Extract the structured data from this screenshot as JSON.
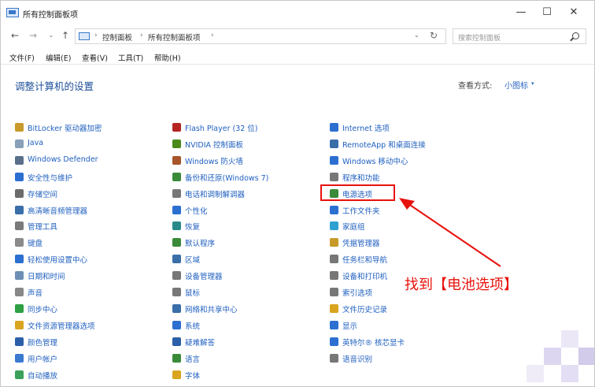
{
  "window": {
    "title": "所有控制面板项",
    "minimize": "—",
    "maximize": "☐",
    "close": "✕"
  },
  "nav": {
    "back": "←",
    "forward": "→",
    "recent": "⌄",
    "up": "↑",
    "refresh": "↻",
    "dropdown": "⌄"
  },
  "address": {
    "crumbs": [
      "控制面板",
      "所有控制面板项"
    ],
    "separator": "›"
  },
  "search": {
    "placeholder": "搜索控制面板"
  },
  "menu": [
    "文件(F)",
    "编辑(E)",
    "查看(V)",
    "工具(T)",
    "帮助(H)"
  ],
  "page": {
    "title": "调整计算机的设置",
    "view_label": "查看方式:",
    "view_value": "小图标",
    "view_arrow": "▾"
  },
  "columns": [
    [
      {
        "label": "BitLocker 驱动器加密",
        "icon": "bitlocker-icon",
        "color": "#c79a2a"
      },
      {
        "label": "Java",
        "icon": "java-icon",
        "color": "#8aa0b8"
      },
      {
        "label": "Windows Defender",
        "icon": "defender-icon",
        "color": "#5a6f8a"
      },
      {
        "label": "安全性与维护",
        "icon": "flag-icon",
        "color": "#2c6fd1"
      },
      {
        "label": "存储空间",
        "icon": "storage-icon",
        "color": "#6b6b6b"
      },
      {
        "label": "高清晰音频管理器",
        "icon": "audio-manager-icon",
        "color": "#3a6ea8"
      },
      {
        "label": "管理工具",
        "icon": "admin-tools-icon",
        "color": "#7a7a7a"
      },
      {
        "label": "键盘",
        "icon": "keyboard-icon",
        "color": "#8a8a8a"
      },
      {
        "label": "轻松使用设置中心",
        "icon": "ease-of-access-icon",
        "color": "#2c6fd1"
      },
      {
        "label": "日期和时间",
        "icon": "clock-icon",
        "color": "#6d8fb5"
      },
      {
        "label": "声音",
        "icon": "speaker-icon",
        "color": "#888"
      },
      {
        "label": "同步中心",
        "icon": "sync-icon",
        "color": "#2ea043"
      },
      {
        "label": "文件资源管理器选项",
        "icon": "folder-options-icon",
        "color": "#d9a520"
      },
      {
        "label": "颜色管理",
        "icon": "color-management-icon",
        "color": "#2c5fa8"
      },
      {
        "label": "用户帐户",
        "icon": "user-accounts-icon",
        "color": "#3a7ad1"
      },
      {
        "label": "自动播放",
        "icon": "autoplay-icon",
        "color": "#3aa05a"
      }
    ],
    [
      {
        "label": "Flash Player (32 位)",
        "icon": "flash-icon",
        "color": "#b52323"
      },
      {
        "label": "NVIDIA 控制面板",
        "icon": "nvidia-icon",
        "color": "#4a8a1a"
      },
      {
        "label": "Windows 防火墙",
        "icon": "firewall-icon",
        "color": "#a8552a"
      },
      {
        "label": "备份和还原(Windows 7)",
        "icon": "backup-icon",
        "color": "#3a8a3a"
      },
      {
        "label": "电话和调制解调器",
        "icon": "phone-modem-icon",
        "color": "#777"
      },
      {
        "label": "个性化",
        "icon": "personalization-icon",
        "color": "#2c6fd1"
      },
      {
        "label": "恢复",
        "icon": "recovery-icon",
        "color": "#2a8a8a"
      },
      {
        "label": "默认程序",
        "icon": "default-programs-icon",
        "color": "#3a8a3a"
      },
      {
        "label": "区域",
        "icon": "region-icon",
        "color": "#3a6ea8"
      },
      {
        "label": "设备管理器",
        "icon": "device-manager-icon",
        "color": "#777"
      },
      {
        "label": "鼠标",
        "icon": "mouse-icon",
        "color": "#777"
      },
      {
        "label": "网络和共享中心",
        "icon": "network-icon",
        "color": "#3a6ea8"
      },
      {
        "label": "系统",
        "icon": "system-icon",
        "color": "#2c6fd1"
      },
      {
        "label": "疑难解答",
        "icon": "troubleshoot-icon",
        "color": "#2c5fa8"
      },
      {
        "label": "语言",
        "icon": "language-icon",
        "color": "#3a8a3a"
      },
      {
        "label": "字体",
        "icon": "fonts-icon",
        "color": "#d9a520"
      }
    ],
    [
      {
        "label": "Internet 选项",
        "icon": "internet-options-icon",
        "color": "#2c6fd1"
      },
      {
        "label": "RemoteApp 和桌面连接",
        "icon": "remoteapp-icon",
        "color": "#3a6ea8"
      },
      {
        "label": "Windows 移动中心",
        "icon": "mobility-center-icon",
        "color": "#2c6fd1"
      },
      {
        "label": "程序和功能",
        "icon": "programs-features-icon",
        "color": "#777"
      },
      {
        "label": "电源选项",
        "icon": "power-options-icon",
        "color": "#3a8a3a"
      },
      {
        "label": "工作文件夹",
        "icon": "work-folders-icon",
        "color": "#2c6fd1"
      },
      {
        "label": "家庭组",
        "icon": "homegroup-icon",
        "color": "#2ea0d1"
      },
      {
        "label": "凭据管理器",
        "icon": "credential-manager-icon",
        "color": "#c79a2a"
      },
      {
        "label": "任务栏和导航",
        "icon": "taskbar-icon",
        "color": "#777"
      },
      {
        "label": "设备和打印机",
        "icon": "printer-icon",
        "color": "#777"
      },
      {
        "label": "索引选项",
        "icon": "indexing-icon",
        "color": "#777"
      },
      {
        "label": "文件历史记录",
        "icon": "file-history-icon",
        "color": "#d9a520"
      },
      {
        "label": "显示",
        "icon": "display-icon",
        "color": "#2c6fd1"
      },
      {
        "label": "英特尔® 核芯显卡",
        "icon": "intel-graphics-icon",
        "color": "#2c6fd1"
      },
      {
        "label": "语音识别",
        "icon": "microphone-icon",
        "color": "#777"
      }
    ]
  ],
  "annotation": {
    "text": "找到【电池选项】",
    "color": "#e8120d"
  }
}
